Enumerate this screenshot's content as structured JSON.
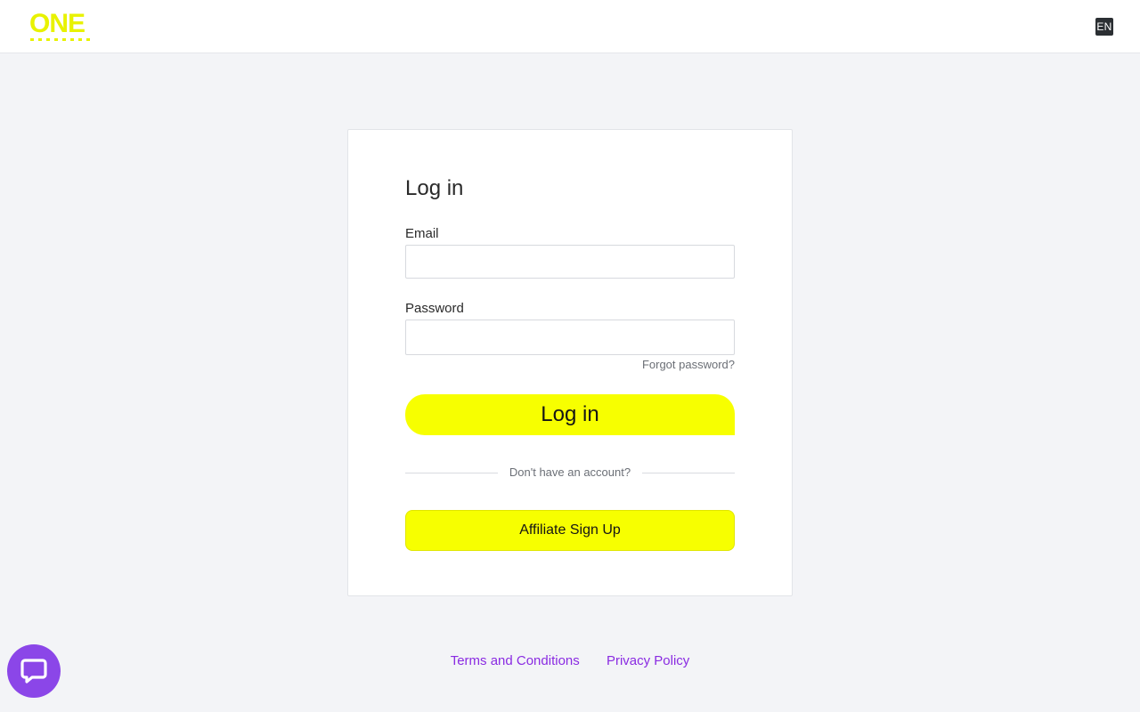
{
  "header": {
    "logo_text": "ONE",
    "logo_subtext": "PARTNERS",
    "language": "EN"
  },
  "login_card": {
    "title": "Log in",
    "email_label": "Email",
    "email_value": "",
    "password_label": "Password",
    "password_value": "",
    "forgot_password": "Forgot password?",
    "login_button": "Log in",
    "no_account_text": "Don't have an account?",
    "signup_button": "Affiliate Sign Up"
  },
  "footer": {
    "terms": "Terms and Conditions",
    "privacy": "Privacy Policy"
  },
  "chat": {
    "icon": "chat-bubble-icon"
  },
  "colors": {
    "accent_yellow": "#f7ff00",
    "link_purple": "#8a2be2",
    "chat_purple": "#8b46e8",
    "page_background": "#f3f4f7"
  }
}
